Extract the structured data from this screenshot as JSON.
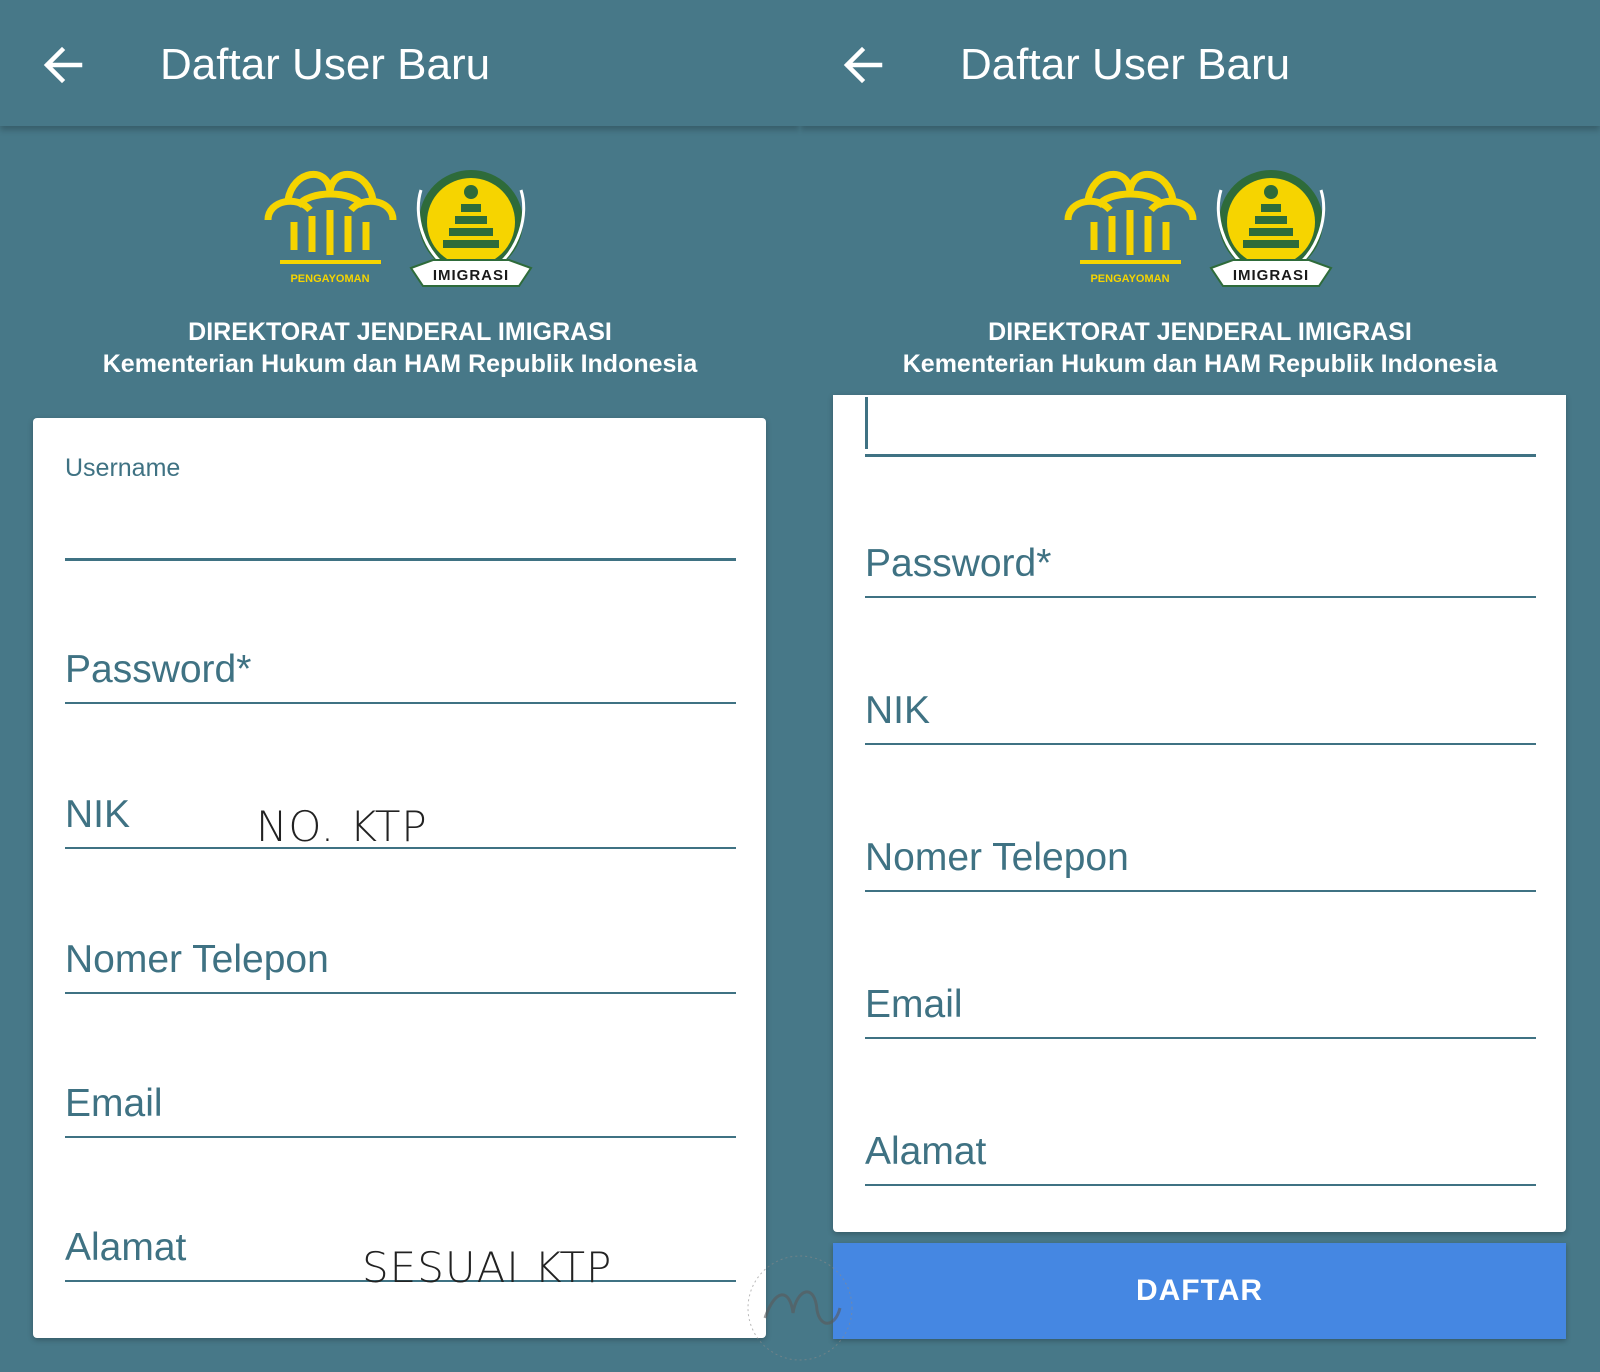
{
  "screens": [
    {
      "appbar": {
        "title": "Daftar User Baru"
      },
      "org": {
        "line1": "DIREKTORAT JENDERAL IMIGRASI",
        "line2": "Kementerian Hukum dan HAM Republik Indonesia"
      },
      "logos": {
        "pengayoman_text": "PENGAYOMAN",
        "imigrasi_text": "IMIGRASI"
      },
      "fields": {
        "username": "Username",
        "password": "Password*",
        "nik": "NIK",
        "telepon": "Nomer Telepon",
        "email": "Email",
        "alamat": "Alamat"
      },
      "annotations": {
        "nik_hint": "NO. KTP",
        "alamat_hint": "SESUAI KTP"
      }
    },
    {
      "appbar": {
        "title": "Daftar User Baru"
      },
      "org": {
        "line1": "DIREKTORAT JENDERAL IMIGRASI",
        "line2": "Kementerian Hukum dan HAM Republik Indonesia"
      },
      "logos": {
        "pengayoman_text": "PENGAYOMAN",
        "imigrasi_text": "IMIGRASI"
      },
      "fields": {
        "password": "Password*",
        "nik": "NIK",
        "telepon": "Nomer Telepon",
        "email": "Email",
        "alamat": "Alamat"
      },
      "submit_label": "DAFTAR"
    }
  ],
  "colors": {
    "primary": "#477888",
    "accent_text": "#3f7283",
    "button": "#4587e2",
    "logo_gold": "#f6d400",
    "logo_green": "#2e6b3a"
  }
}
